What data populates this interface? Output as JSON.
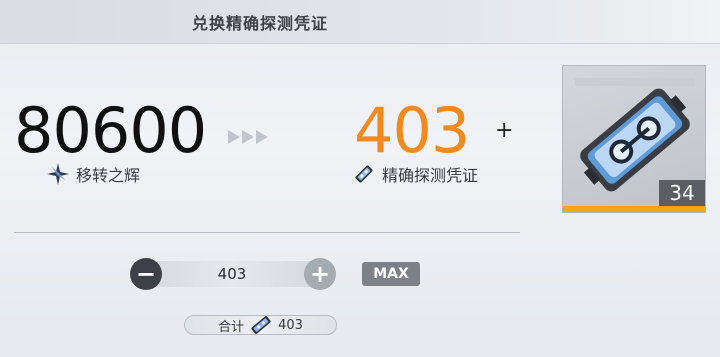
{
  "header": {
    "title": "兑换精确探测凭证"
  },
  "exchange": {
    "from_amount": "80600",
    "from_label": "移转之辉",
    "from_icon": "sparkle-icon",
    "to_amount": "403",
    "to_label": "精确探测凭证",
    "to_icon": "voucher-icon",
    "plus": "+"
  },
  "item_card": {
    "count": "34",
    "accent_color": "#f2a516"
  },
  "quantity": {
    "value": "403",
    "minus": "−",
    "plus": "+",
    "max_label": "MAX"
  },
  "total": {
    "label": "合计",
    "value": "403"
  },
  "colors": {
    "highlight": "#f08a1e",
    "dark_button": "#3d4048"
  }
}
